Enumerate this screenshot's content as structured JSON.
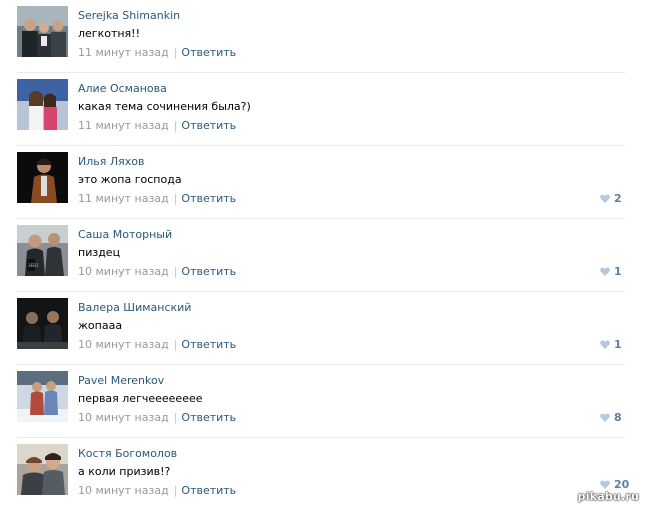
{
  "comments": [
    {
      "author": "Serejka Shimankin",
      "text": "легкотня!!",
      "time": "11 минут назад",
      "reply": "Ответить",
      "likes": null,
      "avatar": "avatar-three-people"
    },
    {
      "author": "Алие Османова",
      "text": "какая тема сочинения была?)",
      "time": "11 минут назад",
      "reply": "Ответить",
      "likes": null,
      "avatar": "avatar-two-girls"
    },
    {
      "author": "Илья Ляхов",
      "text": "это жопа господа",
      "time": "11 минут назад",
      "reply": "Ответить",
      "likes": "2",
      "avatar": "avatar-person-dark"
    },
    {
      "author": "Саша Моторный",
      "text": "пиздец",
      "time": "10 минут назад",
      "reply": "Ответить",
      "likes": "1",
      "avatar": "avatar-selfie"
    },
    {
      "author": "Валера Шиманский",
      "text": "жопааа",
      "time": "10 минут назад",
      "reply": "Ответить",
      "likes": "1",
      "avatar": "avatar-two-dark"
    },
    {
      "author": "Pavel Merenkov",
      "text": "первая легчееееееее",
      "time": "10 минут назад",
      "reply": "Ответить",
      "likes": "8",
      "avatar": "avatar-two-snow"
    },
    {
      "author": "Костя Богомолов",
      "text": "а коли призив!?",
      "time": "10 минут назад",
      "reply": "Ответить",
      "likes": "20",
      "avatar": "avatar-two-guys"
    }
  ],
  "separator": "|",
  "watermark": "pikabu.ru",
  "colors": {
    "link": "#2b587a",
    "meta": "#999999",
    "like": "#5c7fa1",
    "divider": "#e7eaed"
  }
}
